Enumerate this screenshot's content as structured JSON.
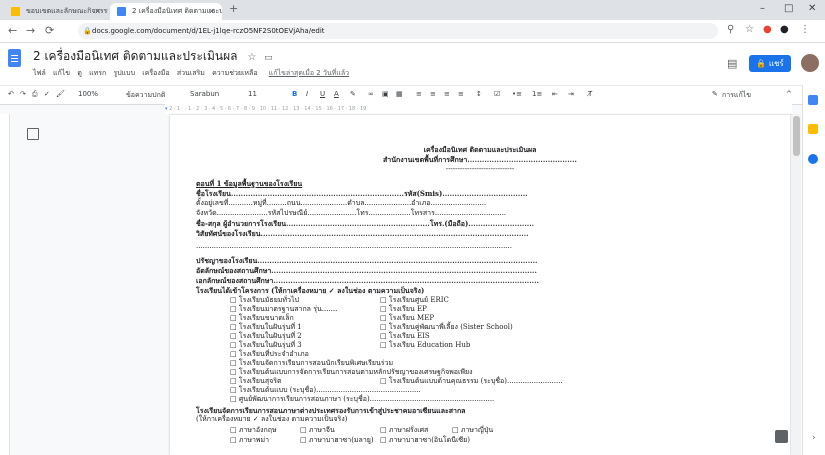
{
  "browser": {
    "tabs": [
      {
        "label": "ขอบเขตและลักษณะกิจกรรม..."
      },
      {
        "label": "2 เครื่องมือนิเทศ ติดตามและประเมินผล"
      }
    ],
    "new_tab": "+",
    "controls": {
      "minimize": "–",
      "maximize": "□",
      "close": "✕"
    },
    "url": "docs.google.com/document/d/1EL-j1lqe-rczO5NF2S0tOEVjAha/edit",
    "icons": [
      "back-icon",
      "forward-icon",
      "reload-icon",
      "lock-icon",
      "bookmark-star-icon"
    ]
  },
  "doc": {
    "title": "2 เครื่องมือนิเทศ ติดตามและประเมินผล",
    "menus": [
      "ไฟล์",
      "แก้ไข",
      "ดู",
      "แทรก",
      "รูปแบบ",
      "เครื่องมือ",
      "ส่วนเสริม",
      "ความช่วยเหลือ"
    ],
    "last_edit": "แก้ไขล่าสุดเมื่อ 2 วันที่แล้ว",
    "share": "แชร์"
  },
  "toolbar": {
    "zoom": "100%",
    "style": "ข้อความปกติ",
    "font": "Sarabun",
    "size": "11",
    "bold": "B",
    "italic": "I",
    "underline": "U",
    "text_color": "A",
    "editing_mode": "การแก้ไข"
  },
  "ruler_ticks": "2 · 1 · · 1 · 2 · 3 · 4 · 5 · 6 · 7 · 8 · 9 · 10 · 11 · 12 · 13 · 14 · 15 · 16 · 17 · 18 · 19",
  "page": {
    "heading1": "เครื่องมือนิเทศ ติดตามและประเมินผล",
    "heading2": "สำนักงานเขตพื้นที่การศึกษา.............................................",
    "divider": "-----------------------------",
    "section1": "ตอนที่ 1 ข้อมูลพื้นฐานของโรงเรียน",
    "lines": [
      "ชื่อโรงเรียน.......................................................................รหัส(Smis)...................................",
      "ตั้งอยู่เลขที่...........หมู่ที่.........ถนน.....................ตำบล.....................อำเภอ.........................",
      "จังหวัด.......................รหัสไปรษณีย์......................โทร...................โทรสาร................................",
      "ชื่อ-สกุล ผู้อำนวยการโรงเรียน...........................................................โทร.(มือถือ)...........................",
      "วิสัยทัศน์ของโรงเรียน..............................................................................................................",
      "..............................................................................................................................................",
      "ปรัชญาของโรงเรียน...................................................................................................................",
      "อัตลักษณ์ของสถานศึกษา.............................................................................................................",
      "เอกลักษณ์ของสถานศึกษา.............................................................................................................",
      "โรงเรียนได้เข้าโครงการ (ให้กาเครื่องหมาย ✓ ลงในช่อง ตามความเป็นจริง)"
    ],
    "checkbox_left": [
      "□ โรงเรียนมัธยมทั่วไป",
      "□ โรงเรียนมาตรฐานสากล รุ่น.......",
      "□ โรงเรียนขนาดเล็ก",
      "□ โรงเรียนในฝันรุ่นที่ 1",
      "□ โรงเรียนในฝันรุ่นที่ 2",
      "□ โรงเรียนในฝันรุ่นที่ 3",
      "□ โรงเรียนที่ประจำอำเภอ",
      "□ โรงเรียนจัดการเรียนการสอนนักเรียนพิเศษเรียนร่วม",
      "□ โรงเรียนต้นแบบการจัดการเรียนการสอนตามหลักปรัชญาของเศรษฐกิจพอเพียง",
      "□ โรงเรียนสุจริต",
      "□ โรงเรียนต้นแบบ (ระบุชื่อ)...............................................",
      "□ ศูนย์พัฒนาการเรียนการสอนภาษา (ระบุชื่อ)........................................................"
    ],
    "checkbox_right": [
      "□ โรงเรียนศูนย์ ERIC",
      "□ โรงเรียน EP",
      "□ โรงเรียน MEP",
      "□ โรงเรียนคู่พัฒนาพี่เลี้ยง (Sister School)",
      "□ โรงเรียน EIS",
      "□ โรงเรียน Education Hub",
      "",
      "",
      "",
      "□ โรงเรียนต้นแบบด้านคุณธรรม (ระบุชื่อ).........................",
      "",
      ""
    ],
    "section2": "โรงเรียนจัดการเรียนการสอนภาษาต่างประเทศรองรับการเข้าสู่ประชาคมอาเซียนและสากล",
    "section2_note": "(ให้กาเครื่องหมาย ✓ ลงในช่อง ตามความเป็นจริง)",
    "lang_row1": [
      "□ ภาษาอังกฤษ",
      "□ ภาษาจีน",
      "□ ภาษาฝรั่งเศส",
      "□ ภาษาญี่ปุ่น"
    ],
    "lang_row2": [
      "□ ภาษาพม่า",
      "□ ภาษาบาฮาซา(มลายู)",
      "□ ภาษาบาฮาซา(อินโดนีเซีย)"
    ]
  }
}
